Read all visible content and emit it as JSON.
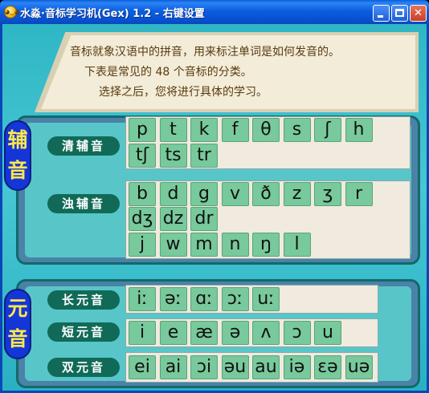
{
  "window": {
    "title": "水淼·音标学习机(Gex) 1.2 - 右键设置",
    "icon": "app-face-icon",
    "minimize": "minimize-icon",
    "maximize": "maximize-icon",
    "close": "close-icon"
  },
  "banner": {
    "line1": "音标就象汉语中的拼音，用来标注单词是如何发音的。",
    "line2": "下表是常见的 48 个音标的分类。",
    "line3": "选择之后，您将进行具体的学习。"
  },
  "consonants": {
    "label_top": "辅",
    "label_bottom": "音",
    "voiceless_label": "清辅音",
    "voiced_label": "浊辅音",
    "voiceless": [
      "p",
      "t",
      "k",
      "f",
      "θ",
      "s",
      "ʃ",
      "h",
      "tʃ",
      "ts",
      "tr"
    ],
    "voiced": [
      "b",
      "d",
      "g",
      "v",
      "ð",
      "z",
      "ʒ",
      "r",
      "dʒ",
      "dz",
      "dr",
      "j",
      "w",
      "m",
      "n",
      "ŋ",
      "l"
    ]
  },
  "vowels": {
    "label_top": "元",
    "label_bottom": "音",
    "long_label": "长元音",
    "short_label": "短元音",
    "diphthong_label": "双元音",
    "long": [
      "iː",
      "əː",
      "ɑː",
      "ɔː",
      "uː"
    ],
    "short": [
      "i",
      "e",
      "æ",
      "ə",
      "ʌ",
      "ɔ",
      "u"
    ],
    "diphthong": [
      "ei",
      "ai",
      "ɔi",
      "əu",
      "au",
      "iə",
      "ɛə",
      "uə"
    ]
  },
  "colors": {
    "title_bar": "#0b5ee0",
    "client_bg": "#47c7d3",
    "key_green": "#78c99c",
    "label_blue": "#1436d8",
    "label_yellow": "#ffe84a"
  }
}
